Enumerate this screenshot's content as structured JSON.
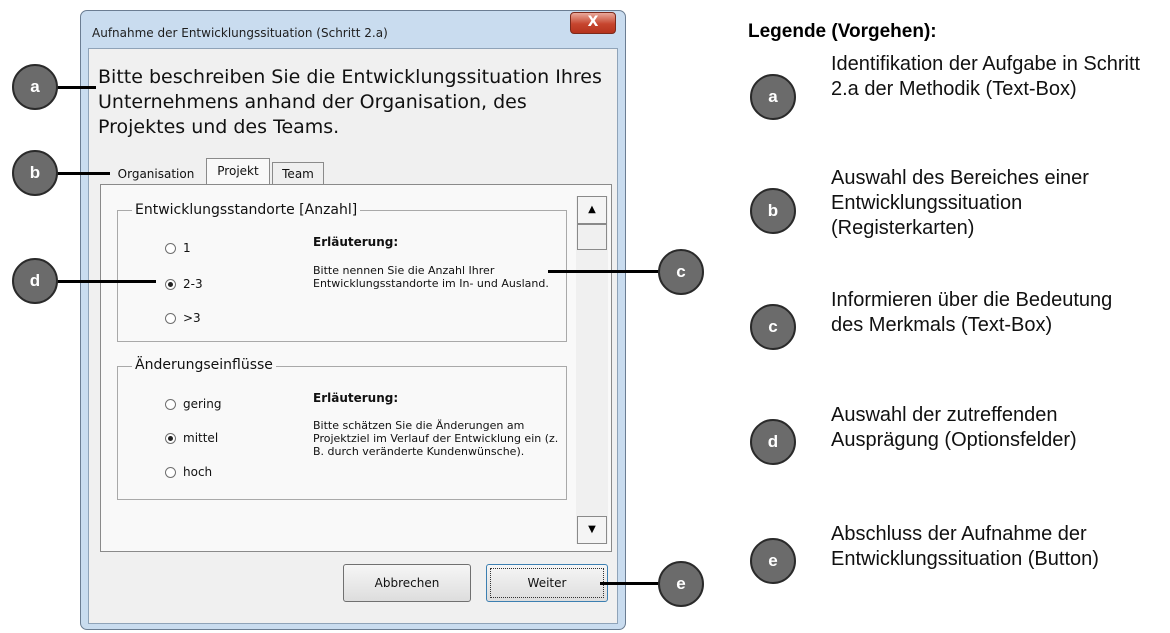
{
  "dialog": {
    "title": "Aufnahme der Entwicklungssituation (Schritt 2.a)",
    "close_label": "X",
    "intro_text": "Bitte beschreiben Sie die Entwicklungssituation Ihres Unternehmens anhand der Organisation, des Projektes und des Teams.",
    "tabs": [
      {
        "label": "Organisation"
      },
      {
        "label": "Projekt"
      },
      {
        "label": "Team"
      }
    ],
    "groups": [
      {
        "title": "Entwicklungsstandorte [Anzahl]",
        "options": [
          {
            "label": "1",
            "checked": false
          },
          {
            "label": "2-3",
            "checked": true
          },
          {
            "label": ">3",
            "checked": false
          }
        ],
        "explanation_heading": "Erläuterung:",
        "explanation_text": "Bitte nennen Sie die Anzahl Ihrer Entwicklungsstandorte im In- und Ausland."
      },
      {
        "title": "Änderungseinflüsse",
        "options": [
          {
            "label": "gering",
            "checked": false
          },
          {
            "label": "mittel",
            "checked": true
          },
          {
            "label": "hoch",
            "checked": false
          }
        ],
        "explanation_heading": "Erläuterung:",
        "explanation_text": "Bitte schätzen Sie die Änderungen am Projektziel im Verlauf der Entwicklung ein (z. B. durch veränderte Kundenwünsche)."
      }
    ],
    "buttons": {
      "cancel": "Abbrechen",
      "next": "Weiter"
    }
  },
  "callouts": [
    "a",
    "b",
    "c",
    "d",
    "e"
  ],
  "legend": {
    "title": "Legende (Vorgehen):",
    "items": [
      {
        "letter": "a",
        "text": "Identifikation der Aufgabe in Schritt 2.a der Methodik (Text-Box)"
      },
      {
        "letter": "b",
        "text": "Auswahl des Bereiches einer Entwicklungssituation (Registerkarten)"
      },
      {
        "letter": "c",
        "text": "Informieren über die Bedeutung des Merkmals (Text-Box)"
      },
      {
        "letter": "d",
        "text": "Auswahl der zutreffenden Ausprägung (Optionsfelder)"
      },
      {
        "letter": "e",
        "text": "Abschluss der Aufnahme der Entwicklungssituation (Button)"
      }
    ]
  },
  "colors": {
    "window_frame": "#c9dcef",
    "close_button": "#c6452e",
    "callout_fill": "#6b6b6b"
  }
}
